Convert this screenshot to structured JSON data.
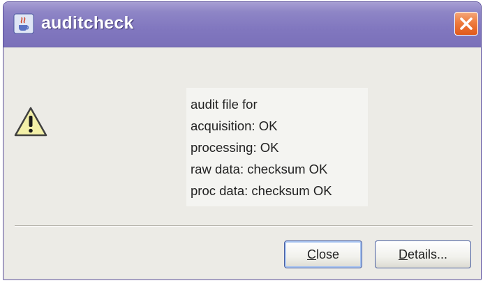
{
  "window": {
    "title": "auditcheck",
    "app_icon": "java-cup-icon",
    "close_icon": "close-x-icon"
  },
  "dialog": {
    "icon": "warning-triangle-icon",
    "message_lines": [
      "audit file for",
      "acquisition: OK",
      "processing: OK",
      "raw data: checksum OK",
      "proc data: checksum OK"
    ]
  },
  "buttons": {
    "close": {
      "mnemonic": "C",
      "rest": "lose"
    },
    "details": {
      "mnemonic": "D",
      "rest": "etails..."
    }
  },
  "colors": {
    "titlebar": "#8177bf",
    "close_button": "#ee7b3e",
    "dialog_background": "#ecebe6",
    "warning_fill": "#f3f0a8"
  }
}
